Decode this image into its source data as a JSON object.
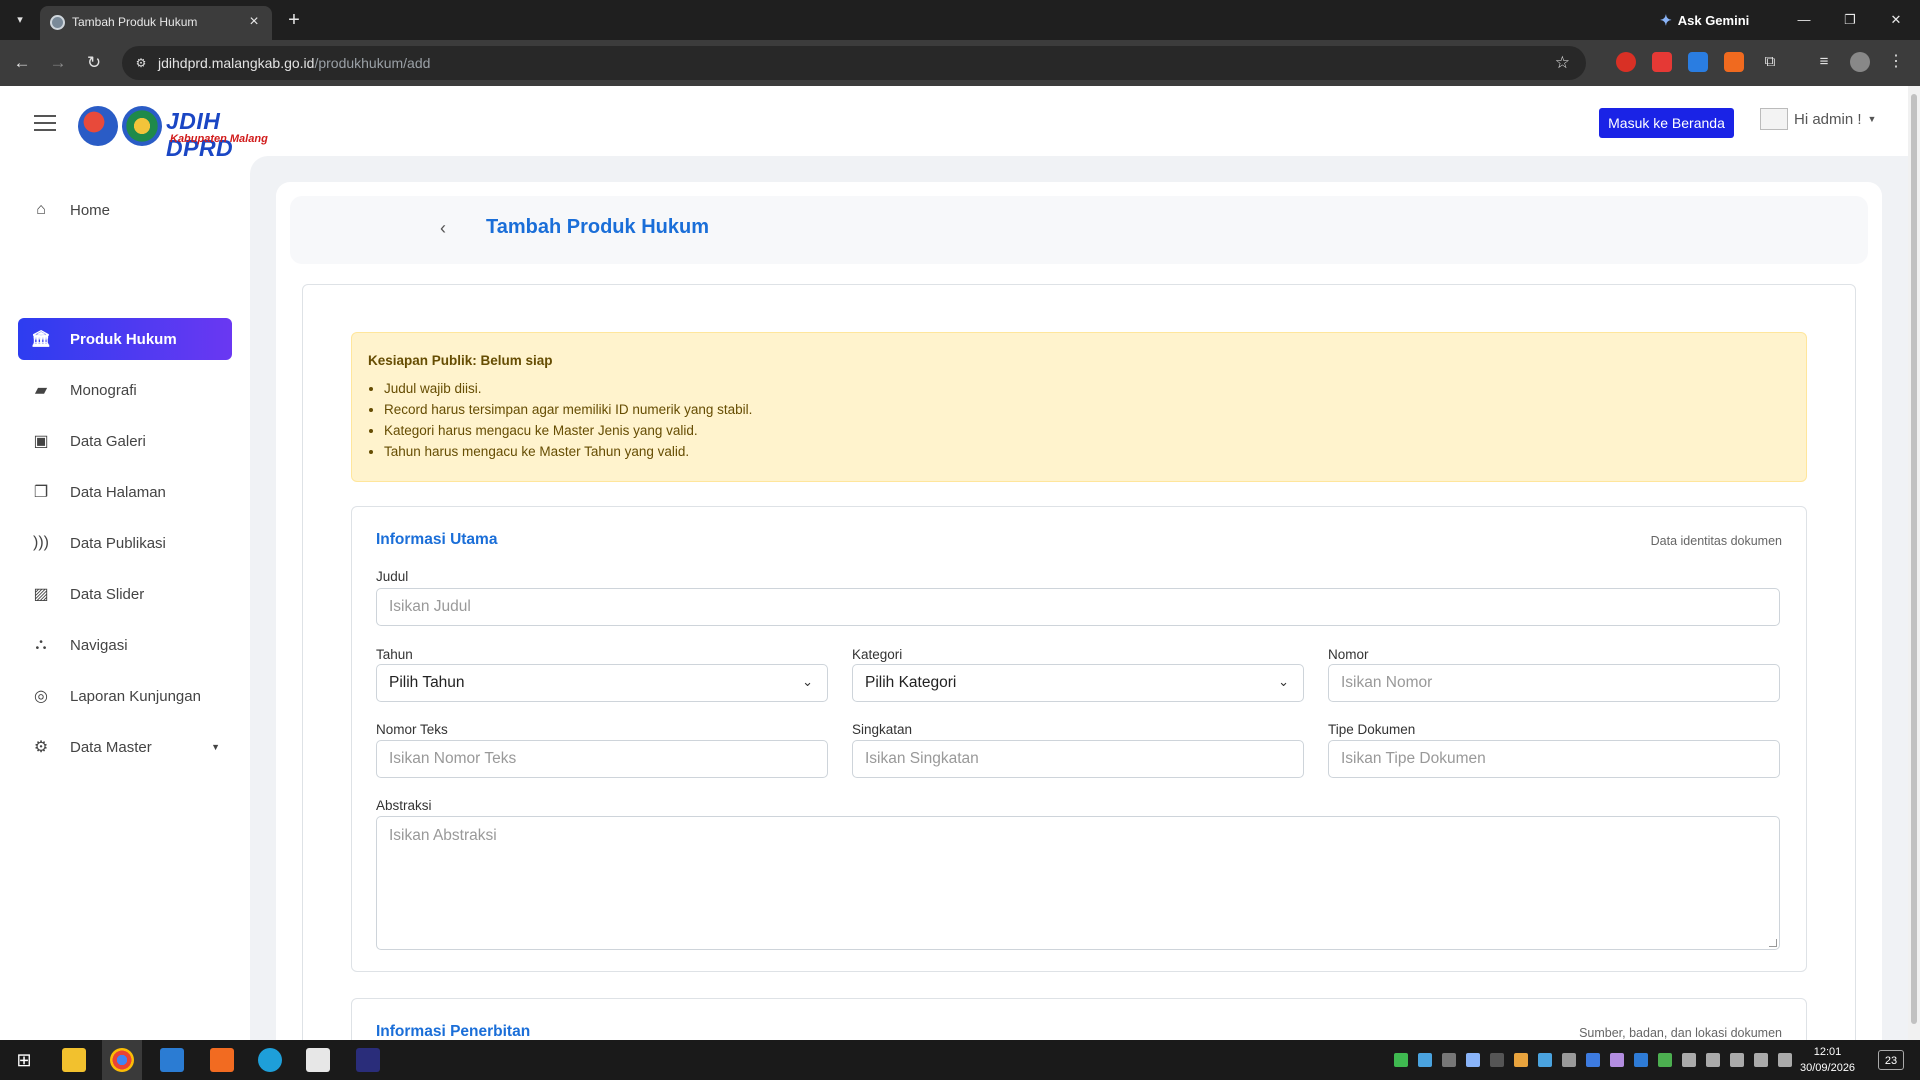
{
  "browser": {
    "tab_title": "Tambah Produk Hukum",
    "ask_gemini": "Ask Gemini",
    "url_host": "jdihdprd.malangkab.go.id",
    "url_path": "/produkhukum/add"
  },
  "header": {
    "logo_title": "JDIH DPRD",
    "logo_subtitle": "Kabupaten Malang",
    "home_button": "Masuk ke Beranda",
    "user_greeting": "Hi admin !"
  },
  "sidebar": {
    "items": [
      {
        "label": "Home",
        "icon": "home-icon"
      },
      {
        "label": "Produk Hukum",
        "icon": "bank-icon",
        "active": true
      },
      {
        "label": "Monografi",
        "icon": "book-icon"
      },
      {
        "label": "Data Galeri",
        "icon": "image-file-icon"
      },
      {
        "label": "Data Halaman",
        "icon": "copy-icon"
      },
      {
        "label": "Data Publikasi",
        "icon": "broadcast-icon"
      },
      {
        "label": "Data Slider",
        "icon": "picture-icon"
      },
      {
        "label": "Navigasi",
        "icon": "sitemap-icon"
      },
      {
        "label": "Laporan Kunjungan",
        "icon": "target-icon"
      },
      {
        "label": "Data Master",
        "icon": "gear-icon"
      }
    ]
  },
  "page": {
    "title": "Tambah Produk Hukum"
  },
  "alert": {
    "title": "Kesiapan Publik: Belum siap",
    "items": [
      "Judul wajib diisi.",
      "Record harus tersimpan agar memiliki ID numerik yang stabil.",
      "Kategori harus mengacu ke Master Jenis yang valid.",
      "Tahun harus mengacu ke Master Tahun yang valid."
    ]
  },
  "section_main": {
    "title": "Informasi Utama",
    "note": "Data identitas dokumen",
    "judul_label": "Judul",
    "judul_placeholder": "Isikan Judul",
    "tahun_label": "Tahun",
    "tahun_value": "Pilih Tahun",
    "kategori_label": "Kategori",
    "kategori_value": "Pilih Kategori",
    "nomor_label": "Nomor",
    "nomor_placeholder": "Isikan Nomor",
    "nomor_teks_label": "Nomor Teks",
    "nomor_teks_placeholder": "Isikan Nomor Teks",
    "singkatan_label": "Singkatan",
    "singkatan_placeholder": "Isikan Singkatan",
    "tipe_label": "Tipe Dokumen",
    "tipe_placeholder": "Isikan Tipe Dokumen",
    "abstraksi_label": "Abstraksi",
    "abstraksi_placeholder": "Isikan Abstraksi"
  },
  "section_pub": {
    "title": "Informasi Penerbitan",
    "note": "Sumber, badan, dan lokasi dokumen"
  },
  "taskbar": {
    "time": "12:01",
    "date": "30/09/2026",
    "notifications": "23"
  },
  "colors": {
    "accent": "#1a6ed8",
    "button": "#1a23e6",
    "alert_bg": "#fff3cd",
    "active_gradient_start": "#2d3df0",
    "active_gradient_end": "#6a38f2"
  }
}
